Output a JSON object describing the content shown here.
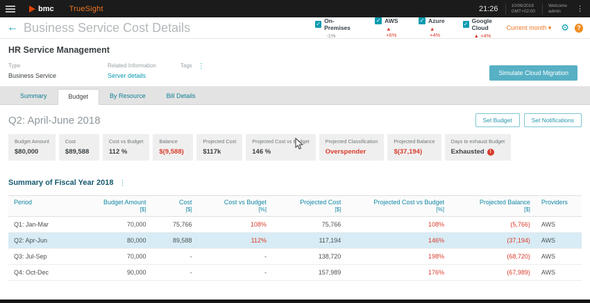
{
  "colors": {
    "accent_teal": "#0a9bb0",
    "brand_orange": "#ef7622",
    "logo_red": "#dc4405",
    "negative_red": "#d93b2b",
    "selected_row": "#d8ecf5"
  },
  "topbar": {
    "brand": "bmc",
    "product": "TrueSight",
    "time": "21:26",
    "date": "10/06/2018",
    "timezone": "GMT+02:00",
    "welcome": "Welcome",
    "user": "admin"
  },
  "header": {
    "title": "Business Service Cost Details",
    "providers": [
      {
        "label": "On-Premises",
        "delta": "-1%",
        "up": false
      },
      {
        "label": "AWS",
        "delta": "▲ +6%",
        "up": true
      },
      {
        "label": "Azure",
        "delta": "▲ +4%",
        "up": true
      },
      {
        "label": "Google Cloud",
        "delta": "▲ +4%",
        "up": true
      }
    ],
    "period_selector": "Current month ▾",
    "check_glyph": "✓",
    "help_glyph": "?"
  },
  "service": {
    "name": "HR Service Management",
    "type_label": "Type",
    "type_value": "Business Service",
    "related_label": "Related Information",
    "related_link": "Server details",
    "tags_label": "Tags",
    "simulate_button": "Simulate Cloud Migration"
  },
  "tabs": [
    {
      "label": "Summary",
      "active": false
    },
    {
      "label": "Budget",
      "active": true
    },
    {
      "label": "By Resource",
      "active": false
    },
    {
      "label": "Bill Details",
      "active": false
    }
  ],
  "quarter": {
    "title": "Q2: April-June 2018",
    "set_budget_button": "Set Budget",
    "set_notifications_button": "Set Notifications"
  },
  "metrics": [
    {
      "label": "Budget Amount",
      "value": "$80,000",
      "negative": false
    },
    {
      "label": "Cost",
      "value": "$89,588",
      "negative": false
    },
    {
      "label": "Cost vs Budget",
      "value": "112 %",
      "negative": false
    },
    {
      "label": "Balance",
      "value": "$(9,588)",
      "negative": true
    },
    {
      "label": "Projected Cost",
      "value": "$117k",
      "negative": false
    },
    {
      "label": "Projected Cost vs Budget",
      "value": "146 %",
      "negative": false
    },
    {
      "label": "Projected Classification",
      "value": "Overspender",
      "negative": true
    },
    {
      "label": "Projected Balance",
      "value": "$(37,194)",
      "negative": true
    },
    {
      "label": "Days to exhaust Budget",
      "value": "Exhausted",
      "negative": false,
      "warning": "!"
    }
  ],
  "fiscal": {
    "title": "Summary of Fiscal Year 2018",
    "columns": [
      {
        "label": "Period",
        "unit": ""
      },
      {
        "label": "Budget Amount",
        "unit": "[$]"
      },
      {
        "label": "Cost",
        "unit": "[$]"
      },
      {
        "label": "Cost vs Budget",
        "unit": "[%]"
      },
      {
        "label": "Projected Cost",
        "unit": "[$]"
      },
      {
        "label": "Projected Cost vs Budget",
        "unit": "[%]"
      },
      {
        "label": "Projected Balance",
        "unit": "[$]"
      },
      {
        "label": "Providers",
        "unit": ""
      }
    ],
    "rows": [
      {
        "period": "Q1: Jan-Mar",
        "budget": "70,000",
        "cost": "75,766",
        "cost_vs": "108%",
        "proj_cost": "75,766",
        "proj_vs": "108%",
        "proj_balance": "(5,766)",
        "provider": "AWS",
        "selected": false
      },
      {
        "period": "Q2: Apr-Jun",
        "budget": "80,000",
        "cost": "89,588",
        "cost_vs": "112%",
        "proj_cost": "117,194",
        "proj_vs": "146%",
        "proj_balance": "(37,194)",
        "provider": "AWS",
        "selected": true
      },
      {
        "period": "Q3: Jul-Sep",
        "budget": "70,000",
        "cost": "-",
        "cost_vs": "-",
        "proj_cost": "138,720",
        "proj_vs": "198%",
        "proj_balance": "(68,720)",
        "provider": "AWS",
        "selected": false
      },
      {
        "period": "Q4: Oct-Dec",
        "budget": "90,000",
        "cost": "-",
        "cost_vs": "-",
        "proj_cost": "157,989",
        "proj_vs": "176%",
        "proj_balance": "(67,989)",
        "provider": "AWS",
        "selected": false
      }
    ]
  }
}
